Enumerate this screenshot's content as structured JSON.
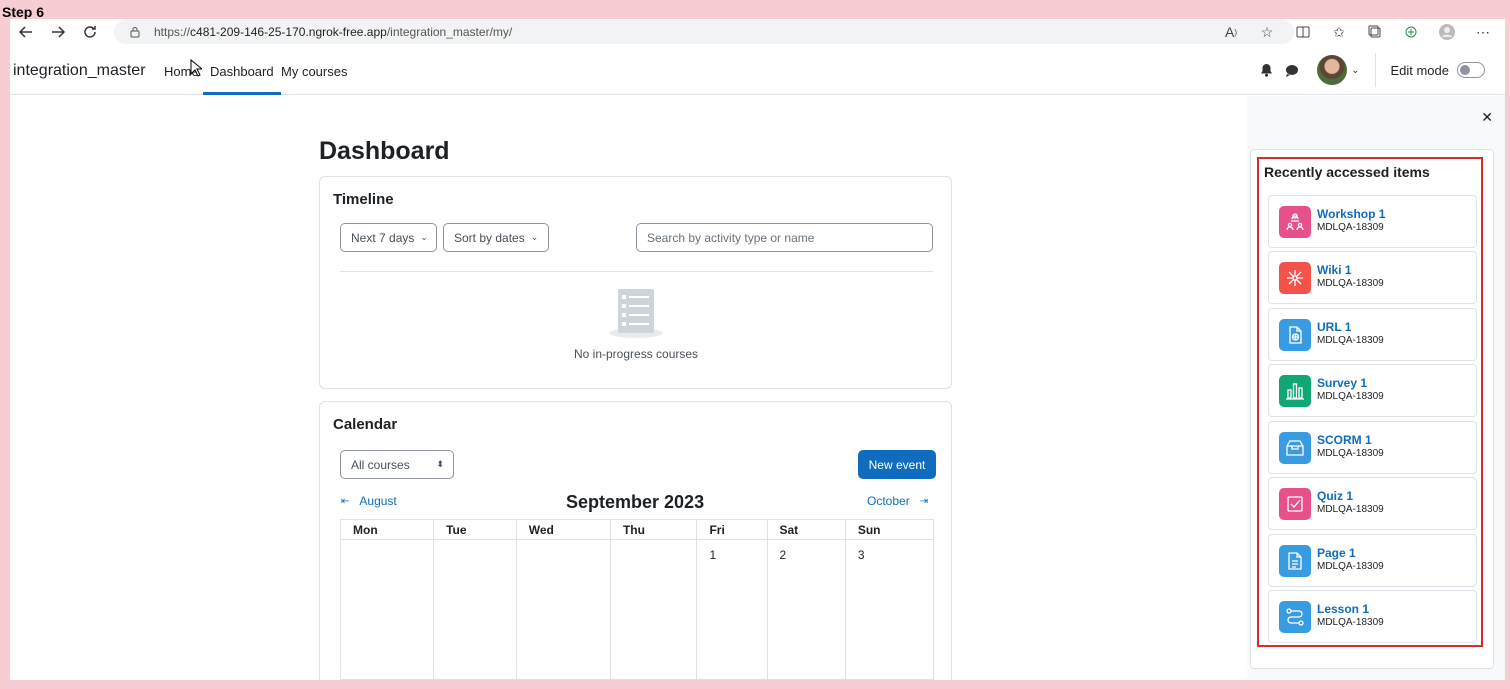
{
  "step_label": "Step 6",
  "browser": {
    "url_prefix": "https://",
    "url_host": "c481-209-146-25-170.ngrok-free.app",
    "url_path": "/integration_master/my/"
  },
  "navbar": {
    "brand": "integration_master",
    "links": [
      "Home",
      "Dashboard",
      "My courses"
    ],
    "edit_mode_label": "Edit mode"
  },
  "page": {
    "title": "Dashboard"
  },
  "timeline": {
    "title": "Timeline",
    "range_select": "Next 7 days",
    "sort_select": "Sort by dates",
    "search_placeholder": "Search by activity type or name",
    "empty_text": "No in-progress courses"
  },
  "calendar": {
    "title": "Calendar",
    "course_select": "All courses",
    "new_event": "New event",
    "prev_month": "August",
    "month_title": "September 2023",
    "next_month": "October",
    "weekdays": [
      "Mon",
      "Tue",
      "Wed",
      "Thu",
      "Fri",
      "Sat",
      "Sun"
    ],
    "days": [
      "",
      "",
      "",
      "",
      "1",
      "2",
      "3"
    ]
  },
  "recent": {
    "title": "Recently accessed items",
    "items": [
      {
        "name": "Workshop 1",
        "course": "MDLQA-18309",
        "color": "#e6518c",
        "icon": "workshop-icon"
      },
      {
        "name": "Wiki 1",
        "course": "MDLQA-18309",
        "color": "#f4534b",
        "icon": "wiki-icon"
      },
      {
        "name": "URL 1",
        "course": "MDLQA-18309",
        "color": "#399be2",
        "icon": "url-icon"
      },
      {
        "name": "Survey 1",
        "course": "MDLQA-18309",
        "color": "#11a676",
        "icon": "survey-icon"
      },
      {
        "name": "SCORM 1",
        "course": "MDLQA-18309",
        "color": "#399be2",
        "icon": "scorm-icon"
      },
      {
        "name": "Quiz 1",
        "course": "MDLQA-18309",
        "color": "#e6518c",
        "icon": "quiz-icon"
      },
      {
        "name": "Page 1",
        "course": "MDLQA-18309",
        "color": "#399be2",
        "icon": "page-icon"
      },
      {
        "name": "Lesson 1",
        "course": "MDLQA-18309",
        "color": "#399be2",
        "icon": "lesson-icon"
      }
    ]
  }
}
